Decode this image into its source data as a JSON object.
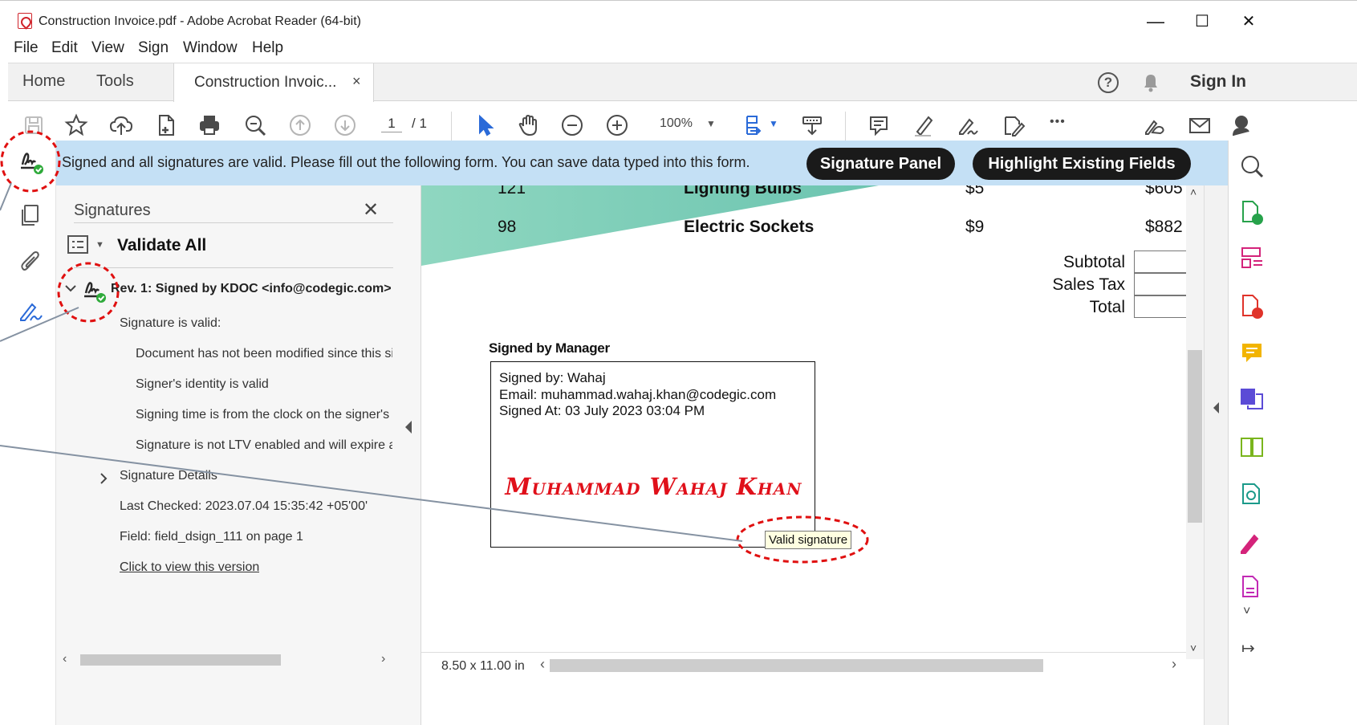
{
  "window": {
    "title": "Construction Invoice.pdf - Adobe Acrobat Reader (64-bit)",
    "controls": {
      "minimize": "—",
      "maximize": "☐",
      "close": "✕"
    }
  },
  "menu": [
    "File",
    "Edit",
    "View",
    "Sign",
    "Window",
    "Help"
  ],
  "tabs": {
    "home": "Home",
    "tools": "Tools",
    "document": "Construction Invoic...",
    "close": "×",
    "sign_in": "Sign In"
  },
  "toolbar": {
    "page_current": "1",
    "page_total": "/ 1",
    "zoom": "100%",
    "more": "•••"
  },
  "message_bar": {
    "text": "Signed and all signatures are valid.  Please fill out the following form. You can save data typed into this form.",
    "signature_panel_button": "Signature Panel",
    "highlight_fields_button": "Highlight Existing Fields"
  },
  "signatures_panel": {
    "title": "Signatures",
    "close": "✕",
    "validate_all": "Validate All",
    "revision": "Rev. 1: Signed by KDOC <info@codegic.com>",
    "status": "Signature is valid:",
    "details": [
      "Document has not been modified since this signature was applied",
      "Signer's identity is valid",
      "Signing time is from the clock on the signer's computer.",
      "Signature is not LTV enabled and will expire after"
    ],
    "signature_details": "Signature Details",
    "last_checked": "Last Checked: 2023.07.04 15:35:42 +05'00'",
    "field": "Field: field_dsign_111 on page 1",
    "view_version": "Click to view this version"
  },
  "document": {
    "rows": [
      {
        "qty": "121",
        "item": "Lighting Bulbs",
        "price": "$5",
        "amount": "$605"
      },
      {
        "qty": "98",
        "item": "Electric Sockets",
        "price": "$9",
        "amount": "$882"
      }
    ],
    "totals": [
      "Subtotal",
      "Sales Tax",
      "Total"
    ],
    "signed_heading": "Signed by Manager",
    "signature_box": {
      "line1": "Signed by: Wahaj",
      "line2": "Email: muhammad.wahaj.khan@codegic.com",
      "line3": "Signed At: 03 July 2023 03:04 PM",
      "signature": "Muhammad Wahaj Khan"
    },
    "tooltip": "Valid signature",
    "page_size": "8.50 x 11.00 in"
  },
  "colors": {
    "message_bar": "#c4e0f5",
    "teal_band": "#8fd4be",
    "signature_red": "#e0101a",
    "callout_red": "#e01010",
    "valid_green": "#2eaa3a"
  }
}
